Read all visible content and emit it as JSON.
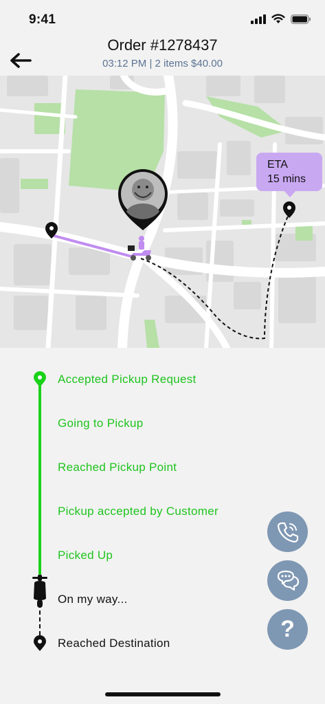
{
  "status_bar": {
    "time": "9:41"
  },
  "header": {
    "title": "Order #1278437",
    "subtitle": "03:12 PM | 2 items $40.00"
  },
  "map": {
    "eta_label": "ETA",
    "eta_value": "15 mins",
    "colors": {
      "route_done": "#c08cf0",
      "route_pending": "#111111",
      "park": "#b5e0a8",
      "road": "#ffffff",
      "block": "#dcdcdc"
    }
  },
  "timeline": {
    "steps": [
      {
        "label": "Accepted Pickup Request",
        "state": "done"
      },
      {
        "label": "Going to Pickup",
        "state": "done"
      },
      {
        "label": "Reached Pickup Point",
        "state": "done"
      },
      {
        "label": "Pickup accepted by Customer",
        "state": "done"
      },
      {
        "label": "Picked Up",
        "state": "done"
      },
      {
        "label": "On my way...",
        "state": "current"
      },
      {
        "label": "Reached Destination",
        "state": "pending"
      }
    ],
    "colors": {
      "done": "#1ec41e",
      "pending": "#111111"
    }
  },
  "actions": {
    "call_icon": "phone-icon",
    "chat_icon": "chat-icon",
    "help_label": "?",
    "button_color": "#7e97b3"
  }
}
